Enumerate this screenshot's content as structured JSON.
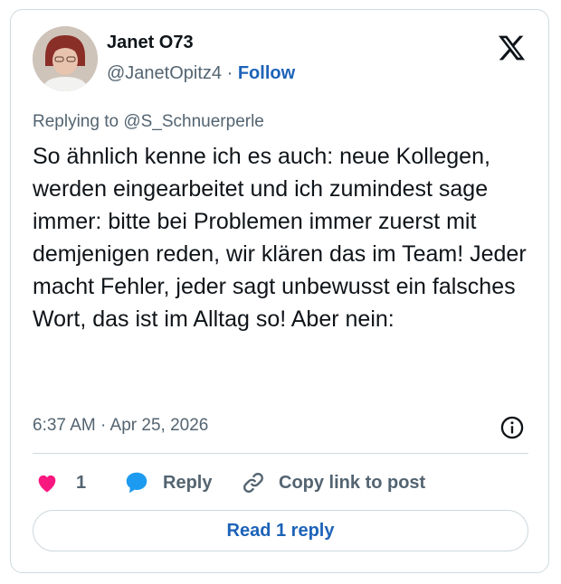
{
  "author": {
    "display_name": "Janet O73",
    "handle": "@JanetOpitz4",
    "separator": "·",
    "follow_label": "Follow"
  },
  "post": {
    "replying_to": "Replying to @S_Schnuerperle",
    "text": "So ähnlich kenne ich es auch: neue Kollegen, werden eingearbeitet und ich zumindest sage immer: bitte bei Problemen immer zuerst mit demjenigen reden, wir klären das im Team! Jeder macht Fehler, jeder sagt unbewusst ein falsches Wort, das ist im Alltag so! Aber nein:",
    "timestamp": "6:37 AM · Apr 25, 2026"
  },
  "actions": {
    "like_count": "1",
    "reply_label": "Reply",
    "copy_link_label": "Copy link to post"
  },
  "read_replies_label": "Read 1 reply",
  "icons": {
    "logo": "x-logo-icon",
    "info": "info-icon",
    "like": "heart-icon",
    "reply": "speech-bubble-icon",
    "copy": "link-icon"
  },
  "colors": {
    "accent": "#1d63b8",
    "like": "#f91880",
    "reply": "#1d9bf0",
    "muted": "#536471",
    "text": "#0f1419",
    "border": "#cfd9de"
  }
}
